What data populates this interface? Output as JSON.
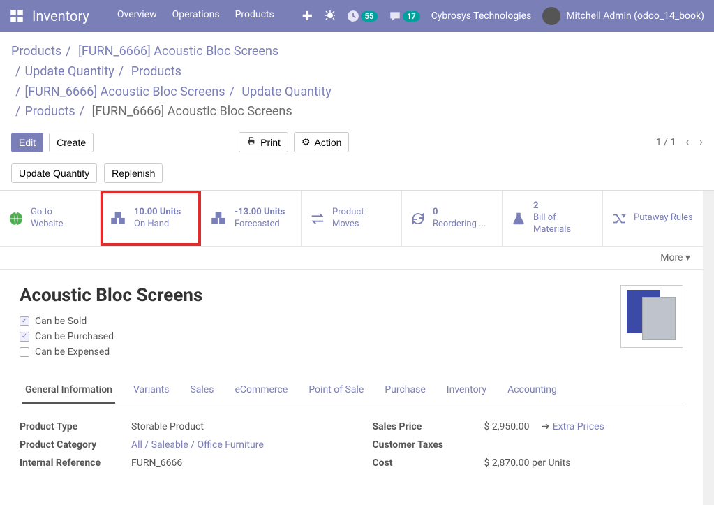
{
  "topnav": {
    "app_title": "Inventory",
    "menu": [
      "Overview",
      "Operations",
      "Products"
    ],
    "badge_timer": "55",
    "badge_chat": "17",
    "company": "Cybrosys Technologies",
    "user": "Mitchell Admin (odoo_14_book)"
  },
  "breadcrumbs": [
    {
      "text": "Products",
      "link": true
    },
    {
      "text": "[FURN_6666] Acoustic Bloc Screens",
      "link": true
    },
    {
      "text": "Update Quantity",
      "link": true
    },
    {
      "text": "Products",
      "link": true
    },
    {
      "text": "[FURN_6666] Acoustic Bloc Screens",
      "link": true
    },
    {
      "text": "Update Quantity",
      "link": true
    },
    {
      "text": "Products",
      "link": true
    },
    {
      "text": "[FURN_6666] Acoustic Bloc Screens",
      "link": false
    }
  ],
  "toolbar": {
    "edit": "Edit",
    "create": "Create",
    "print": "Print",
    "action": "Action",
    "pager": "1 / 1"
  },
  "subtoolbar": {
    "update_qty": "Update Quantity",
    "replenish": "Replenish"
  },
  "stats": {
    "goto": {
      "line1": "Go to",
      "line2": "Website"
    },
    "onhand": {
      "val": "10.00 Units",
      "label": "On Hand"
    },
    "forecast": {
      "val": "-13.00 Units",
      "label": "Forecasted"
    },
    "moves": {
      "label": "Product Moves"
    },
    "reorder": {
      "val": "0",
      "label": "Reordering ..."
    },
    "bom": {
      "val": "2",
      "label": "Bill of Materials"
    },
    "putaway": {
      "label": "Putaway Rules"
    },
    "more": "More"
  },
  "product": {
    "name": "Acoustic Bloc Screens",
    "can_be_sold": "Can be Sold",
    "can_be_purchased": "Can be Purchased",
    "can_be_expensed": "Can be Expensed"
  },
  "tabs": [
    "General Information",
    "Variants",
    "Sales",
    "eCommerce",
    "Point of Sale",
    "Purchase",
    "Inventory",
    "Accounting"
  ],
  "fields_left": {
    "product_type": {
      "label": "Product Type",
      "value": "Storable Product"
    },
    "product_category": {
      "label": "Product Category",
      "value": "All / Saleable / Office Furniture"
    },
    "internal_ref": {
      "label": "Internal Reference",
      "value": "FURN_6666"
    }
  },
  "fields_right": {
    "sales_price": {
      "label": "Sales Price",
      "value": "$ 2,950.00",
      "extra": "Extra Prices"
    },
    "customer_taxes": {
      "label": "Customer Taxes",
      "value": ""
    },
    "cost": {
      "label": "Cost",
      "value": "$ 2,870.00 per Units"
    }
  }
}
